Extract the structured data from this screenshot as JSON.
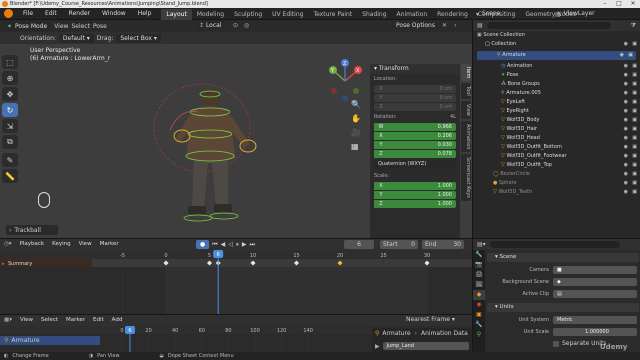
{
  "window": {
    "title": "Blender* [F:\\Udemy_Course_Resources\\Animations\\Jumping\\Stand_Jump.blend]"
  },
  "menu": {
    "items": [
      "File",
      "Edit",
      "Render",
      "Window",
      "Help"
    ],
    "workspaces": [
      "Layout",
      "Modeling",
      "Sculpting",
      "UV Editing",
      "Texture Paint",
      "Shading",
      "Animation",
      "Rendering",
      "Compositing",
      "Geometry Nodes"
    ],
    "scene_label": "Scene",
    "viewlayer_label": "ViewLayer"
  },
  "viewport": {
    "mode": "Pose Mode",
    "menus": [
      "View",
      "Select",
      "Pose"
    ],
    "orientation_label": "Orientation:",
    "orientation_value": "Default",
    "drag_label": "Drag:",
    "drag_value": "Select Box",
    "pivot_value": "Local",
    "pose_options": "Pose Options",
    "overlay_title": "User Perspective",
    "overlay_object": "(6) Armature : LowerArm_r",
    "op_panel": "Trackball",
    "axis_x": "X",
    "axis_y": "Y",
    "axis_z": "Z"
  },
  "transform_panel": {
    "header": "Transform",
    "location_label": "Location:",
    "location": [
      {
        "axis": "X",
        "value": "0 cm"
      },
      {
        "axis": "Y",
        "value": "0 cm"
      },
      {
        "axis": "Z",
        "value": "0 cm"
      }
    ],
    "rotation_label": "Rotation:",
    "rotation_mode_short": "4L",
    "rotation": [
      {
        "axis": "W",
        "value": "0.966"
      },
      {
        "axis": "X",
        "value": "0.206"
      },
      {
        "axis": "Y",
        "value": "0.030"
      },
      {
        "axis": "Z",
        "value": "0.078"
      }
    ],
    "rotation_mode": "Quaternion (WXYZ)",
    "scale_label": "Scale:",
    "scale": [
      {
        "axis": "X",
        "value": "1.000"
      },
      {
        "axis": "Y",
        "value": "1.000"
      },
      {
        "axis": "Z",
        "value": "1.000"
      }
    ]
  },
  "n_tabs": [
    "Item",
    "Tool",
    "View",
    "Animation",
    "Screencast Keys"
  ],
  "outliner": {
    "title": "Scene Collection",
    "rows": [
      {
        "label": "Scene Collection",
        "indent": 0
      },
      {
        "label": "Collection",
        "indent": 1
      },
      {
        "label": "Armature",
        "indent": 2
      },
      {
        "label": "Animation",
        "indent": 3
      },
      {
        "label": "Pose",
        "indent": 3
      },
      {
        "label": "Bone Groups",
        "indent": 3
      },
      {
        "label": "Armature.005",
        "indent": 3
      },
      {
        "label": "EyeLeft",
        "indent": 3
      },
      {
        "label": "EyeRight",
        "indent": 3
      },
      {
        "label": "Wolf3D_Body",
        "indent": 3
      },
      {
        "label": "Wolf3D_Hair",
        "indent": 3
      },
      {
        "label": "Wolf3D_Head",
        "indent": 3
      },
      {
        "label": "Wolf3D_Outfit_Bottom",
        "indent": 3
      },
      {
        "label": "Wolf3D_Outfit_Footwear",
        "indent": 3
      },
      {
        "label": "Wolf3D_Outfit_Top",
        "indent": 3
      },
      {
        "label": "BezierCircle",
        "indent": 2
      },
      {
        "label": "Sphere",
        "indent": 2
      },
      {
        "label": "Wolf3D_Teeth",
        "indent": 2
      }
    ]
  },
  "timeline": {
    "menus": [
      "Playback",
      "Keying",
      "View",
      "Marker"
    ],
    "current_frame": "6",
    "start_label": "Start",
    "start_value": "0",
    "end_label": "End",
    "end_value": "30",
    "ruler": [
      "-5",
      "0",
      "5",
      "10",
      "15",
      "20",
      "25",
      "30"
    ],
    "summary_label": "Summary",
    "keys": [
      0,
      5,
      6,
      10,
      15,
      20,
      30
    ]
  },
  "nla": {
    "menus": [
      "View",
      "Select",
      "Marker",
      "Edit",
      "Add"
    ],
    "nearest_frame": "Nearest Frame",
    "frame_badge": "6",
    "ruler": [
      "0",
      "20",
      "40",
      "60",
      "80",
      "100",
      "120",
      "140"
    ],
    "track_label": "Armature",
    "armature_label": "Armature",
    "animation_data": "Animation Data",
    "action_name": "Jump_Land"
  },
  "properties": {
    "scene_section": "Scene",
    "camera_label": "Camera",
    "background_label": "Background Scene",
    "active_clip_label": "Active Clip",
    "units_section": "Units",
    "unit_system_label": "Unit System",
    "unit_system_value": "Metric",
    "unit_scale_label": "Unit Scale",
    "unit_scale_value": "1.000000",
    "separate_units_label": "Separate Units"
  },
  "status": {
    "left": "Change Frame",
    "middle": "Pan View",
    "right": "Dope Sheet Context Menu"
  },
  "watermark": "Udemy",
  "colors": {
    "accent_blue": "#4772b3",
    "active_green": "#3c8a3c",
    "keyframe_yellow": "#e8c030",
    "playhead_blue": "#4b8fe0",
    "summary_orange": "#c0762a"
  }
}
